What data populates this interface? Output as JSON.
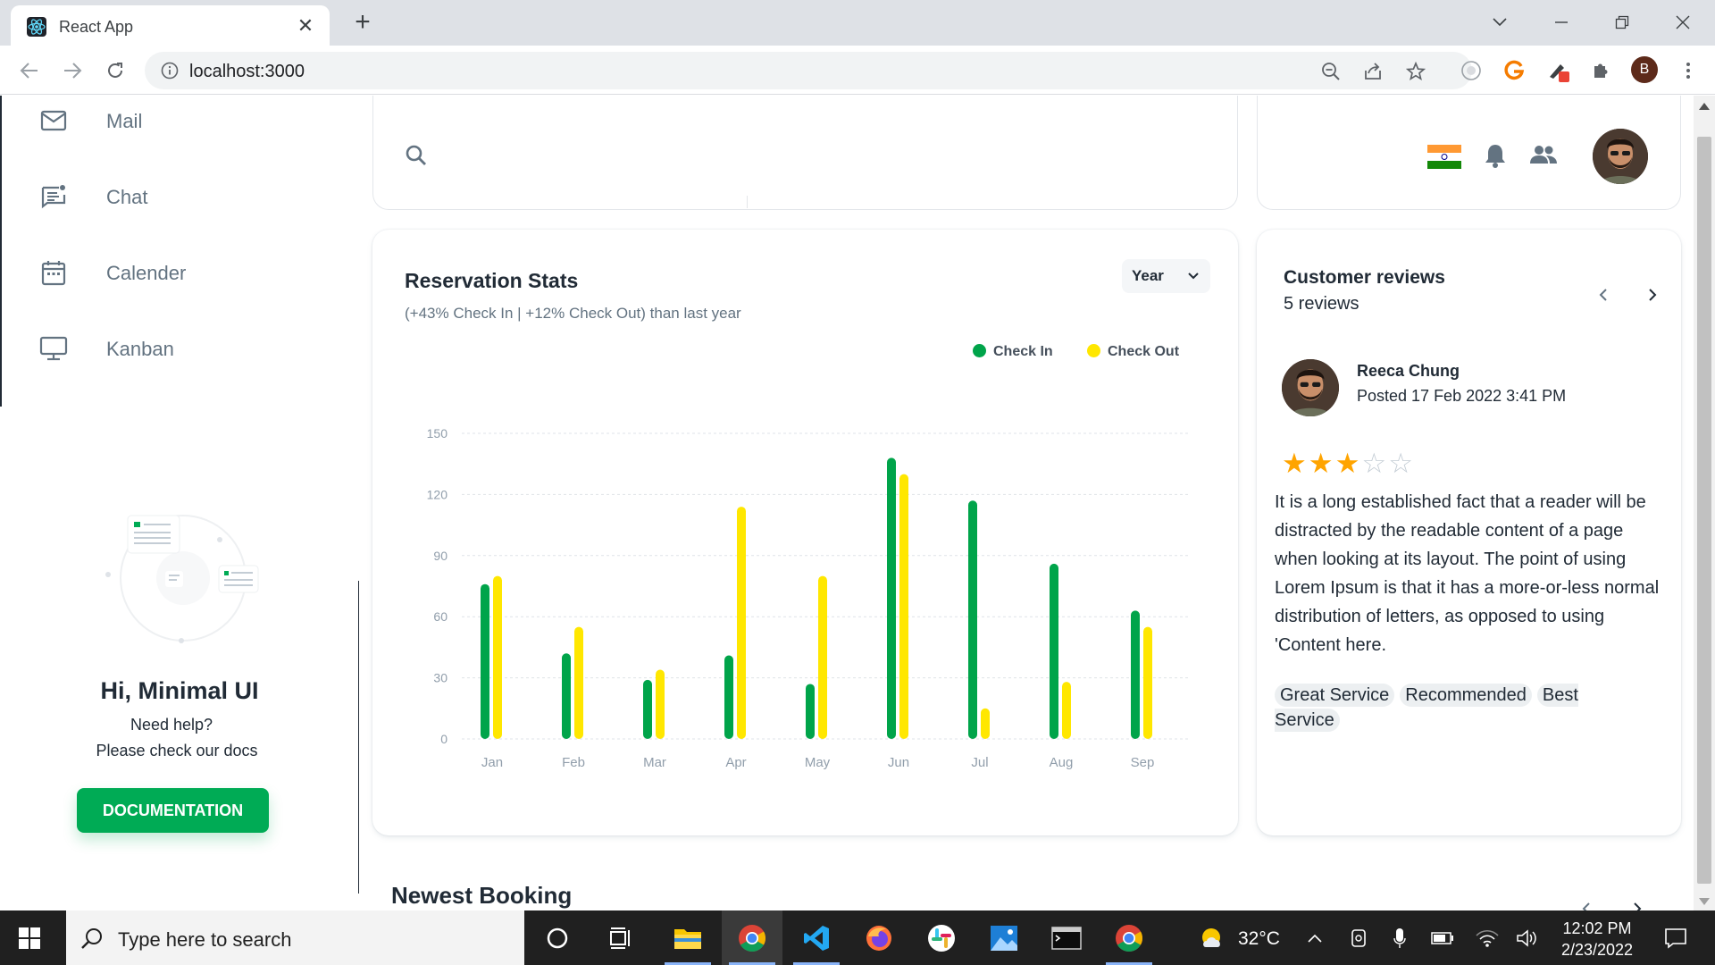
{
  "browser": {
    "tab_title": "React App",
    "url": "localhost:3000",
    "profile_initial": "B"
  },
  "sidebar": {
    "items": [
      {
        "label": "Mail",
        "icon": "mail-icon"
      },
      {
        "label": "Chat",
        "icon": "chat-icon"
      },
      {
        "label": "Calender",
        "icon": "calendar-icon"
      },
      {
        "label": "Kanban",
        "icon": "kanban-icon"
      }
    ],
    "greeting": "Hi, Minimal UI",
    "help_line1": "Need help?",
    "help_line2": "Please check our docs",
    "doc_button": "DOCUMENTATION"
  },
  "header": {
    "icons": [
      "search-icon",
      "india-flag-icon",
      "bell-icon",
      "contacts-icon",
      "avatar"
    ]
  },
  "stats": {
    "title": "Reservation Stats",
    "subtitle": "(+43% Check In | +12% Check Out) than last year",
    "period": "Year"
  },
  "chart_data": {
    "type": "bar",
    "categories": [
      "Jan",
      "Feb",
      "Mar",
      "Apr",
      "May",
      "Jun",
      "Jul",
      "Aug",
      "Sep"
    ],
    "series": [
      {
        "name": "Check In",
        "color": "#00a44a",
        "values": [
          76,
          42,
          29,
          41,
          27,
          138,
          117,
          86,
          63
        ]
      },
      {
        "name": "Check Out",
        "color": "#ffe700",
        "values": [
          80,
          55,
          34,
          114,
          80,
          130,
          15,
          28,
          55
        ]
      }
    ],
    "yticks": [
      "0",
      "30",
      "60",
      "90",
      "120",
      "150"
    ],
    "ylim": [
      0,
      150
    ],
    "grid": true,
    "legend_position": "top-right"
  },
  "reviews": {
    "title": "Customer reviews",
    "count": "5 reviews",
    "author": "Reeca Chung",
    "posted": "Posted 17 Feb 2022 3:41 PM",
    "rating": 3,
    "max_rating": 5,
    "body": "It is a long established fact that a reader will be distracted by the readable content of a page when looking at its layout. The point of using Lorem Ipsum is that it has a more-or-less normal distribution of letters, as opposed to using 'Content here.",
    "tags": [
      "Great Service",
      "Recommended",
      "Best Service"
    ]
  },
  "newest_booking": {
    "title": "Newest Booking"
  },
  "taskbar": {
    "search_placeholder": "Type here to search",
    "temperature": "32°C",
    "time": "12:02 PM",
    "date": "2/23/2022"
  }
}
